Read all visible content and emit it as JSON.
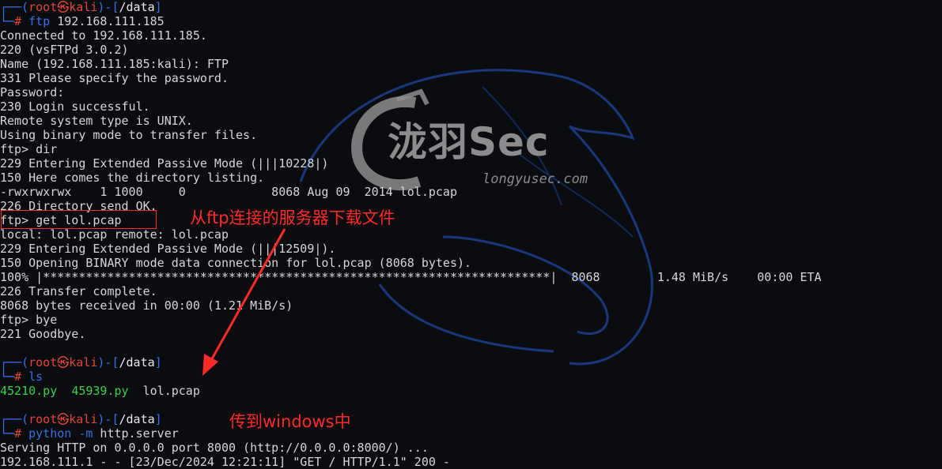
{
  "colors": {
    "background": "#0b0c10",
    "prompt_frame": "#3b6fe0",
    "prompt_root": "#e0463c",
    "text": "#d6d6d6",
    "filename_green": "#3bd14a",
    "annotation_red": "#ff2a2a"
  },
  "watermark": {
    "logo_text": "泷羽Sec",
    "url": "longyusec.com"
  },
  "session1": {
    "prompt": {
      "user": "root",
      "sym": "㉿",
      "host": "kali",
      "path": "/data"
    },
    "cmd_name": "ftp",
    "cmd_arg": " 192.168.111.185",
    "out": [
      "Connected to 192.168.111.185.",
      "220 (vsFTPd 3.0.2)",
      "Name (192.168.111.185:kali): FTP",
      "331 Please specify the password.",
      "Password:",
      "230 Login successful.",
      "Remote system type is UNIX.",
      "Using binary mode to transfer files.",
      "ftp> dir",
      "229 Entering Extended Passive Mode (|||10228|)",
      "150 Here comes the directory listing.",
      "-rwxrwxrwx    1 1000     0            8068 Aug 09  2014 lol.pcap",
      "226 Directory send OK.",
      "ftp> get lol.pcap",
      "local: lol.pcap remote: lol.pcap",
      "229 Entering Extended Passive Mode (|||12509|).",
      "150 Opening BINARY mode data connection for lol.pcap (8068 bytes).",
      "100% |***********************************************************************|  8068        1.48 MiB/s    00:00 ETA",
      "226 Transfer complete.",
      "8068 bytes received in 00:00 (1.21 MiB/s)",
      "ftp> bye",
      "221 Goodbye."
    ]
  },
  "session2": {
    "prompt": {
      "user": "root",
      "sym": "㉿",
      "host": "kali",
      "path": "/data"
    },
    "cmd": "ls",
    "files_green": [
      "45210.py",
      "45939.py"
    ],
    "file_plain": "lol.pcap"
  },
  "session3": {
    "prompt": {
      "user": "root",
      "sym": "㉿",
      "host": "kali",
      "path": "/data"
    },
    "cmd_name": "python",
    "cmd_flag": " -m",
    "cmd_arg": " http.server",
    "out": [
      "Serving HTTP on 0.0.0.0 port 8000 (http://0.0.0.0:8000/) ...",
      "192.168.111.1 - - [23/Dec/2024 12:21:11] \"GET / HTTP/1.1\" 200 -"
    ]
  },
  "annotations": {
    "note1": "从ftp连接的服务器下载文件",
    "note2": "传到windows中"
  }
}
